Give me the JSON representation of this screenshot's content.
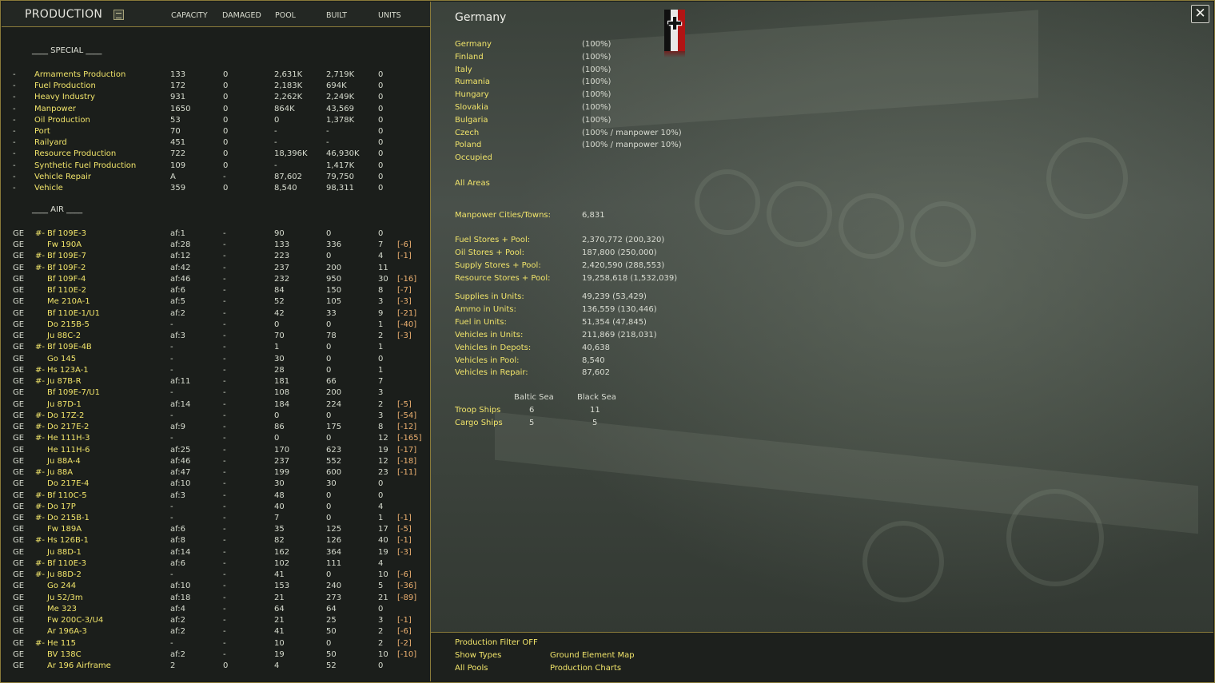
{
  "left_panel": {
    "title": "PRODUCTION",
    "filter_icon": "filter-toggle-icon",
    "columns": [
      "CAPACITY",
      "DAMAGED",
      "POOL",
      "BUILT",
      "UNITS"
    ],
    "special_label": "____ SPECIAL ____",
    "air_label": "____ AIR  ____",
    "special_rows": [
      {
        "c0": "-",
        "name": "Armaments Production",
        "capacity": "133",
        "damaged": "0",
        "pool": "2,631K",
        "built": "2,719K",
        "units": "0"
      },
      {
        "c0": "-",
        "name": "Fuel Production",
        "capacity": "172",
        "damaged": "0",
        "pool": "2,183K",
        "built": "694K",
        "units": "0"
      },
      {
        "c0": "-",
        "name": "Heavy Industry",
        "capacity": "931",
        "damaged": "0",
        "pool": "2,262K",
        "built": "2,249K",
        "units": "0"
      },
      {
        "c0": "-",
        "name": "Manpower",
        "capacity": "1650",
        "damaged": "0",
        "pool": "864K",
        "built": "43,569",
        "units": "0"
      },
      {
        "c0": "-",
        "name": "Oil Production",
        "capacity": "53",
        "damaged": "0",
        "pool": "0",
        "built": "1,378K",
        "units": "0"
      },
      {
        "c0": "-",
        "name": "Port",
        "capacity": "70",
        "damaged": "0",
        "pool": "-",
        "built": "-",
        "units": "0"
      },
      {
        "c0": "-",
        "name": "Railyard",
        "capacity": "451",
        "damaged": "0",
        "pool": "-",
        "built": "-",
        "units": "0"
      },
      {
        "c0": "-",
        "name": "Resource Production",
        "capacity": "722",
        "damaged": "0",
        "pool": "18,396K",
        "built": "46,930K",
        "units": "0"
      },
      {
        "c0": "-",
        "name": "Synthetic Fuel Production",
        "capacity": "109",
        "damaged": "0",
        "pool": "-",
        "built": "1,417K",
        "units": "0"
      },
      {
        "c0": "-",
        "name": "Vehicle Repair",
        "capacity": "A",
        "damaged": "-",
        "pool": "87,602",
        "built": "79,750",
        "units": "0"
      },
      {
        "c0": "-",
        "name": "Vehicle",
        "capacity": "359",
        "damaged": "0",
        "pool": "8,540",
        "built": "98,311",
        "units": "0"
      }
    ],
    "air_rows": [
      {
        "nat": "GE",
        "mark": "#-",
        "name": "Bf 109E-3",
        "capacity": "af:1",
        "damaged": "-",
        "pool": "90",
        "built": "0",
        "units": "0",
        "net": ""
      },
      {
        "nat": "GE",
        "mark": "",
        "name": "Fw 190A",
        "capacity": "af:28",
        "damaged": "-",
        "pool": "133",
        "built": "336",
        "units": "7",
        "net": "[-6]"
      },
      {
        "nat": "GE",
        "mark": "#-",
        "name": "Bf 109E-7",
        "capacity": "af:12",
        "damaged": "-",
        "pool": "223",
        "built": "0",
        "units": "4",
        "net": "[-1]"
      },
      {
        "nat": "GE",
        "mark": "#-",
        "name": "Bf 109F-2",
        "capacity": "af:42",
        "damaged": "-",
        "pool": "237",
        "built": "200",
        "units": "11",
        "net": ""
      },
      {
        "nat": "GE",
        "mark": "",
        "name": "Bf 109F-4",
        "capacity": "af:46",
        "damaged": "-",
        "pool": "232",
        "built": "950",
        "units": "30",
        "net": "[-16]"
      },
      {
        "nat": "GE",
        "mark": "",
        "name": "Bf 110E-2",
        "capacity": "af:6",
        "damaged": "-",
        "pool": "84",
        "built": "150",
        "units": "8",
        "net": "[-7]"
      },
      {
        "nat": "GE",
        "mark": "",
        "name": "Me 210A-1",
        "capacity": "af:5",
        "damaged": "-",
        "pool": "52",
        "built": "105",
        "units": "3",
        "net": "[-3]"
      },
      {
        "nat": "GE",
        "mark": "",
        "name": "Bf 110E-1/U1",
        "capacity": "af:2",
        "damaged": "-",
        "pool": "42",
        "built": "33",
        "units": "9",
        "net": "[-21]"
      },
      {
        "nat": "GE",
        "mark": "",
        "name": "Do 215B-5",
        "capacity": "-",
        "damaged": "-",
        "pool": "0",
        "built": "0",
        "units": "1",
        "net": "[-40]"
      },
      {
        "nat": "GE",
        "mark": "",
        "name": "Ju 88C-2",
        "capacity": "af:3",
        "damaged": "-",
        "pool": "70",
        "built": "78",
        "units": "2",
        "net": "[-3]"
      },
      {
        "nat": "GE",
        "mark": "#-",
        "name": "Bf 109E-4B",
        "capacity": "-",
        "damaged": "-",
        "pool": "1",
        "built": "0",
        "units": "1",
        "net": ""
      },
      {
        "nat": "GE",
        "mark": "",
        "name": "Go 145",
        "capacity": "-",
        "damaged": "-",
        "pool": "30",
        "built": "0",
        "units": "0",
        "net": ""
      },
      {
        "nat": "GE",
        "mark": "#-",
        "name": "Hs 123A-1",
        "capacity": "-",
        "damaged": "-",
        "pool": "28",
        "built": "0",
        "units": "1",
        "net": ""
      },
      {
        "nat": "GE",
        "mark": "#-",
        "name": "Ju 87B-R",
        "capacity": "af:11",
        "damaged": "-",
        "pool": "181",
        "built": "66",
        "units": "7",
        "net": ""
      },
      {
        "nat": "GE",
        "mark": "",
        "name": "Bf 109E-7/U1",
        "capacity": "-",
        "damaged": "-",
        "pool": "108",
        "built": "200",
        "units": "3",
        "net": ""
      },
      {
        "nat": "GE",
        "mark": "",
        "name": "Ju 87D-1",
        "capacity": "af:14",
        "damaged": "-",
        "pool": "184",
        "built": "224",
        "units": "2",
        "net": "[-5]"
      },
      {
        "nat": "GE",
        "mark": "#-",
        "name": "Do 17Z-2",
        "capacity": "-",
        "damaged": "-",
        "pool": "0",
        "built": "0",
        "units": "3",
        "net": "[-54]"
      },
      {
        "nat": "GE",
        "mark": "#-",
        "name": "Do 217E-2",
        "capacity": "af:9",
        "damaged": "-",
        "pool": "86",
        "built": "175",
        "units": "8",
        "net": "[-12]"
      },
      {
        "nat": "GE",
        "mark": "#-",
        "name": "He 111H-3",
        "capacity": "-",
        "damaged": "-",
        "pool": "0",
        "built": "0",
        "units": "12",
        "net": "[-165]"
      },
      {
        "nat": "GE",
        "mark": "",
        "name": "He 111H-6",
        "capacity": "af:25",
        "damaged": "-",
        "pool": "170",
        "built": "623",
        "units": "19",
        "net": "[-17]"
      },
      {
        "nat": "GE",
        "mark": "",
        "name": "Ju 88A-4",
        "capacity": "af:46",
        "damaged": "-",
        "pool": "237",
        "built": "552",
        "units": "12",
        "net": "[-18]"
      },
      {
        "nat": "GE",
        "mark": "#-",
        "name": "Ju 88A",
        "capacity": "af:47",
        "damaged": "-",
        "pool": "199",
        "built": "600",
        "units": "23",
        "net": "[-11]"
      },
      {
        "nat": "GE",
        "mark": "",
        "name": "Do 217E-4",
        "capacity": "af:10",
        "damaged": "-",
        "pool": "30",
        "built": "30",
        "units": "0",
        "net": ""
      },
      {
        "nat": "GE",
        "mark": "#-",
        "name": "Bf 110C-5",
        "capacity": "af:3",
        "damaged": "-",
        "pool": "48",
        "built": "0",
        "units": "0",
        "net": ""
      },
      {
        "nat": "GE",
        "mark": "#-",
        "name": "Do 17P",
        "capacity": "-",
        "damaged": "-",
        "pool": "40",
        "built": "0",
        "units": "4",
        "net": ""
      },
      {
        "nat": "GE",
        "mark": "#-",
        "name": "Do 215B-1",
        "capacity": "-",
        "damaged": "-",
        "pool": "7",
        "built": "0",
        "units": "1",
        "net": "[-1]"
      },
      {
        "nat": "GE",
        "mark": "",
        "name": "Fw 189A",
        "capacity": "af:6",
        "damaged": "-",
        "pool": "35",
        "built": "125",
        "units": "17",
        "net": "[-5]"
      },
      {
        "nat": "GE",
        "mark": "#-",
        "name": "Hs 126B-1",
        "capacity": "af:8",
        "damaged": "-",
        "pool": "82",
        "built": "126",
        "units": "40",
        "net": "[-1]"
      },
      {
        "nat": "GE",
        "mark": "",
        "name": "Ju 88D-1",
        "capacity": "af:14",
        "damaged": "-",
        "pool": "162",
        "built": "364",
        "units": "19",
        "net": "[-3]"
      },
      {
        "nat": "GE",
        "mark": "#-",
        "name": "Bf 110E-3",
        "capacity": "af:6",
        "damaged": "-",
        "pool": "102",
        "built": "111",
        "units": "4",
        "net": ""
      },
      {
        "nat": "GE",
        "mark": "#-",
        "name": "Ju 88D-2",
        "capacity": "-",
        "damaged": "-",
        "pool": "41",
        "built": "0",
        "units": "10",
        "net": "[-6]"
      },
      {
        "nat": "GE",
        "mark": "",
        "name": "Go 244",
        "capacity": "af:10",
        "damaged": "-",
        "pool": "153",
        "built": "240",
        "units": "5",
        "net": "[-36]"
      },
      {
        "nat": "GE",
        "mark": "",
        "name": "Ju 52/3m",
        "capacity": "af:18",
        "damaged": "-",
        "pool": "21",
        "built": "273",
        "units": "21",
        "net": "[-89]"
      },
      {
        "nat": "GE",
        "mark": "",
        "name": "Me 323",
        "capacity": "af:4",
        "damaged": "-",
        "pool": "64",
        "built": "64",
        "units": "0",
        "net": ""
      },
      {
        "nat": "GE",
        "mark": "",
        "name": "Fw 200C-3/U4",
        "capacity": "af:2",
        "damaged": "-",
        "pool": "21",
        "built": "25",
        "units": "3",
        "net": "[-1]"
      },
      {
        "nat": "GE",
        "mark": "",
        "name": "Ar 196A-3",
        "capacity": "af:2",
        "damaged": "-",
        "pool": "41",
        "built": "50",
        "units": "2",
        "net": "[-6]"
      },
      {
        "nat": "GE",
        "mark": "#-",
        "name": "He 115",
        "capacity": "-",
        "damaged": "-",
        "pool": "10",
        "built": "0",
        "units": "2",
        "net": "[-2]"
      },
      {
        "nat": "GE",
        "mark": "",
        "name": "BV 138C",
        "capacity": "af:2",
        "damaged": "-",
        "pool": "19",
        "built": "50",
        "units": "10",
        "net": "[-10]"
      },
      {
        "nat": "GE",
        "mark": "",
        "name": "Ar 196 Airframe",
        "capacity": "2",
        "damaged": "0",
        "pool": "4",
        "built": "52",
        "units": "0",
        "net": ""
      }
    ]
  },
  "right_panel": {
    "country": "Germany",
    "flag_icon": "german-flag-icon",
    "close_icon": "close-icon",
    "nations": [
      {
        "name": "Germany",
        "value": "(100%)"
      },
      {
        "name": "Finland",
        "value": "(100%)"
      },
      {
        "name": "Italy",
        "value": "(100%)"
      },
      {
        "name": "Rumania",
        "value": "(100%)"
      },
      {
        "name": "Hungary",
        "value": "(100%)"
      },
      {
        "name": "Slovakia",
        "value": "(100%)"
      },
      {
        "name": "Bulgaria",
        "value": "(100%)"
      },
      {
        "name": "Czech",
        "value": "(100% / manpower 10%)"
      },
      {
        "name": "Poland",
        "value": "(100% / manpower 10%)"
      },
      {
        "name": "Occupied",
        "value": ""
      }
    ],
    "all_areas": "All Areas",
    "manpower": {
      "label": "Manpower Cities/Towns:",
      "value": "6,831"
    },
    "stores": [
      {
        "label": "Fuel Stores + Pool:",
        "value": "2,370,772 (200,320)"
      },
      {
        "label": "Oil Stores + Pool:",
        "value": "187,800 (250,000)"
      },
      {
        "label": "Supply Stores + Pool:",
        "value": "2,420,590 (288,553)"
      },
      {
        "label": "Resource Stores + Pool:",
        "value": "19,258,618 (1,532,039)"
      }
    ],
    "units": [
      {
        "label": "Supplies in Units:",
        "value": "49,239 (53,429)"
      },
      {
        "label": "Ammo in Units:",
        "value": "136,559 (130,446)"
      },
      {
        "label": "Fuel in Units:",
        "value": "51,354 (47,845)"
      },
      {
        "label": "Vehicles in Units:",
        "value": "211,869 (218,031)"
      },
      {
        "label": "Vehicles in Depots:",
        "value": "40,638"
      },
      {
        "label": "Vehicles in Pool:",
        "value": "8,540"
      },
      {
        "label": "Vehicles in Repair:",
        "value": "87,602"
      }
    ],
    "seas": {
      "headers": [
        "Baltic Sea",
        "Black Sea"
      ],
      "rows": [
        {
          "label": "Troop Ships",
          "baltic": "6",
          "black": "11"
        },
        {
          "label": "Cargo Ships",
          "baltic": "5",
          "black": "5"
        }
      ]
    }
  },
  "bottom_bar": {
    "production_filter": "Production Filter OFF",
    "show_types": "Show Types",
    "all_pools": "All Pools",
    "ground_element_map": "Ground Element Map",
    "production_charts": "Production Charts"
  },
  "colors": {
    "accent_yellow": "#f1e46a",
    "net_orange": "#ecb070",
    "border_gold": "#8a7b3a"
  }
}
